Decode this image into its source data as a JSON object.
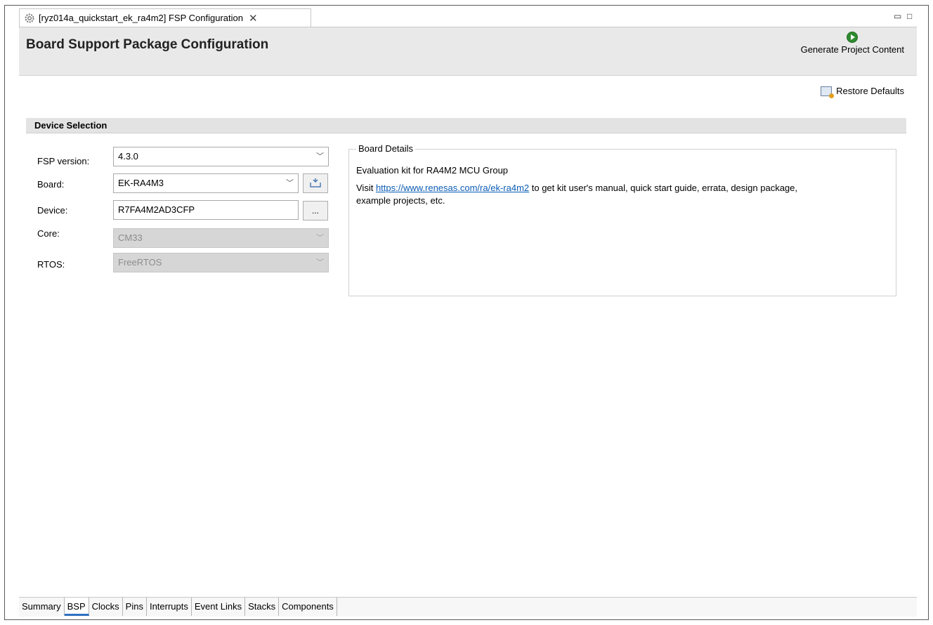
{
  "tab": {
    "title": "[ryz014a_quickstart_ek_ra4m2] FSP Configuration"
  },
  "header": {
    "title": "Board Support Package Configuration",
    "generate_label": "Generate Project Content",
    "restore_label": "Restore Defaults"
  },
  "section": {
    "title": "Device Selection"
  },
  "form": {
    "fsp_version_label": "FSP version:",
    "fsp_version": "4.3.0",
    "board_label": "Board:",
    "board": "EK-RA4M3",
    "device_label": "Device:",
    "device": "R7FA4M2AD3CFP",
    "device_button": "...",
    "core_label": "Core:",
    "core": "CM33",
    "rtos_label": "RTOS:",
    "rtos": "FreeRTOS"
  },
  "board_details": {
    "title": "Board Details",
    "line1": "Evaluation kit for RA4M2 MCU Group",
    "visit": "Visit ",
    "link": "https://www.renesas.com/ra/ek-ra4m2",
    "after_link": " to get kit user's manual, quick start guide, errata, design package,",
    "line3": "example projects, etc."
  },
  "bottom_tabs": [
    "Summary",
    "BSP",
    "Clocks",
    "Pins",
    "Interrupts",
    "Event Links",
    "Stacks",
    "Components"
  ],
  "colors": {
    "accent": "#2f6fc1",
    "link": "#0b5cb5",
    "run": "#2e8b2e"
  }
}
